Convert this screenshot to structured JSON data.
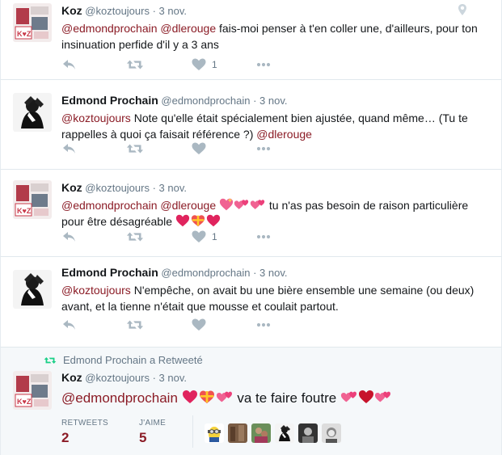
{
  "tweets": [
    {
      "fullname": "Koz",
      "username": "@koztoujours",
      "time": "· 3 nov.",
      "m1": "@edmondprochain",
      "m2": "@dlerouge",
      "text": " fais-moi penser à t'en coller une, d'ailleurs, pour ton insinuation perfide d'il y a 3 ans",
      "likes": "1"
    },
    {
      "fullname": "Edmond Prochain",
      "username": "@edmondprochain",
      "time": "· 3 nov.",
      "m1": "@koztoujours",
      "text": " Note qu'elle était spécialement bien ajustée, quand même… (Tu te rappelles à quoi ça faisait référence ?) ",
      "m2": "@dlerouge"
    },
    {
      "fullname": "Koz",
      "username": "@koztoujours",
      "time": "· 3 nov.",
      "m1": "@edmondprochain",
      "m2": "@dlerouge",
      "text": " tu n'as pas besoin de raison particulière pour être désagréable ",
      "likes": "1"
    },
    {
      "fullname": "Edmond Prochain",
      "username": "@edmondprochain",
      "time": "· 3 nov.",
      "m1": "@koztoujours",
      "text": " N'empêche, on avait bu une bière ensemble une semaine (ou deux) avant, et la tienne n'était que mousse et coulait partout."
    }
  ],
  "retweet": {
    "context": "Edmond Prochain a Retweeté",
    "fullname": "Koz",
    "username": "@koztoujours",
    "time": "· 3 nov.",
    "m1": "@edmondprochain",
    "text": " va te faire foutre ",
    "retweets_label": "RETWEETS",
    "retweets": "2",
    "likes_label": "J'AIME",
    "likes": "5"
  },
  "icons": [
    "reply-icon",
    "retweet-icon",
    "like-icon",
    "more-icon",
    "geo-pin-icon",
    "heart-emoji"
  ],
  "colors": {
    "mention": "#8b1c26",
    "action": "#aab8c2",
    "stat_value": "#8b1c26",
    "retweet_green": "#19cf86"
  }
}
